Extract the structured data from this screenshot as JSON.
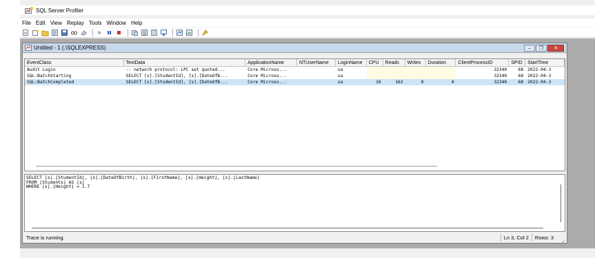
{
  "window": {
    "title": "SQL Server Profiler"
  },
  "menubar": {
    "items": [
      {
        "key": "file",
        "label": "File"
      },
      {
        "key": "edit",
        "label": "Edit"
      },
      {
        "key": "view",
        "label": "View"
      },
      {
        "key": "replay",
        "label": "Replay"
      },
      {
        "key": "tools",
        "label": "Tools"
      },
      {
        "key": "window",
        "label": "Window"
      },
      {
        "key": "help",
        "label": "Help"
      }
    ]
  },
  "toolbar": {
    "buttons": [
      "new-trace-icon",
      "new-template-icon",
      "open-icon",
      "properties-icon",
      "save-icon",
      "find-icon",
      "clear-icon",
      "start-icon",
      "pause-icon",
      "stop-icon",
      "tuning-advisor-icon",
      "activity-monitor-icon",
      "column-view-icon",
      "auto-scroll-icon",
      "server-icon",
      "performance-monitor-icon",
      "help-icon"
    ]
  },
  "trace_window": {
    "title": "Untitled - 1 (.\\SQLEXPRESS)",
    "columns": [
      "EventClass",
      "TextData",
      "ApplicationName",
      "NTUserName",
      "LoginName",
      "CPU",
      "Reads",
      "Writes",
      "Duration",
      "ClientProcessID",
      "SPID",
      "StartTime"
    ],
    "rows": [
      {
        "EventClass": "Audit Login",
        "TextData": "-- network protocol: LPC  set quoted...",
        "ApplicationName": "Core Microso...",
        "NTUserName": "",
        "LoginName": "sa",
        "CPU": "",
        "Reads": "",
        "Writes": "",
        "Duration": "",
        "ClientProcessID": "32340",
        "SPID": "68",
        "StartTime": "2022-04-3"
      },
      {
        "EventClass": "SQL:BatchStarting",
        "TextData": "SELECT [s].[StudentId], [s].[DateOfB...",
        "ApplicationName": "Core Microso...",
        "NTUserName": "",
        "LoginName": "sa",
        "CPU": "",
        "Reads": "",
        "Writes": "",
        "Duration": "",
        "ClientProcessID": "32340",
        "SPID": "68",
        "StartTime": "2022-04-3"
      },
      {
        "EventClass": "SQL:BatchCompleted",
        "TextData": "SELECT [s].[StudentId], [s].[DateOfB...",
        "ApplicationName": "Core Microso...",
        "NTUserName": "",
        "LoginName": "sa",
        "CPU": "16",
        "Reads": "163",
        "Writes": "0",
        "Duration": "4",
        "ClientProcessID": "32340",
        "SPID": "68",
        "StartTime": "2022-04-3",
        "selected": true
      }
    ],
    "detail_text": "SELECT [s].[StudentId], [s].[DateOfBirth], [s].[FirstName], [s].[Height], [s].[LastName]\nFROM [Students] AS [s]\nWHERE [s].[Height] = 1.7"
  },
  "statusbar": {
    "message": "Trace is running.",
    "position": "Ln 3, Col 2",
    "rows": "Rows: 3"
  },
  "colors": {
    "selection": "#cce4f7",
    "stats_cell": "#fffde1",
    "mdi_background": "#ababab",
    "close_button": "#c9463d"
  }
}
